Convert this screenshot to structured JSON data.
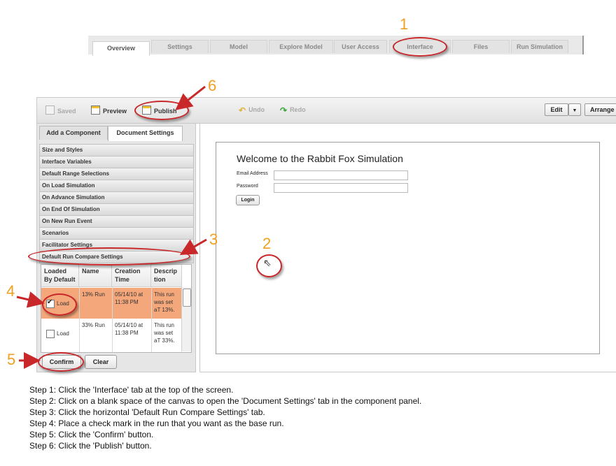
{
  "top_tabs": [
    "Overview",
    "Settings",
    "Model",
    "Explore Model",
    "User Access",
    "Interface",
    "Files",
    "Run Simulation"
  ],
  "step_numbers": [
    "1",
    "2",
    "3",
    "4",
    "5",
    "6"
  ],
  "toolbar": {
    "saved": "Saved",
    "preview": "Preview",
    "publish": "Publish",
    "undo": "Undo",
    "redo": "Redo",
    "edit": "Edit",
    "arrange": "Arrange"
  },
  "panel_tabs": [
    "Add a Component",
    "Document Settings"
  ],
  "sections": [
    "Size and Styles",
    "Interface Variables",
    "Default Range Selections",
    "On Load Simulation",
    "On Advance Simulation",
    "On End Of Simulation",
    "On New Run Event",
    "Scenarios",
    "Facilitator Settings",
    "Default Run Compare Settings"
  ],
  "run_table": {
    "headers": [
      "Loaded By Default",
      "Name",
      "Creation Time",
      "Descrip tion"
    ],
    "rows": [
      {
        "checked": true,
        "load": "Load",
        "name": "13% Run",
        "time": "05/14/10 at 11:38 PM",
        "desc": "This run was set aT 13%."
      },
      {
        "checked": false,
        "load": "Load",
        "name": "33% Run",
        "time": "05/14/10 at 11:38 PM",
        "desc": "This run was set aT 33%."
      }
    ]
  },
  "buttons": {
    "confirm": "Confirm",
    "clear": "Clear"
  },
  "canvas": {
    "title": "Welcome to the Rabbit Fox Simulation",
    "email_label": "Email Address",
    "password_label": "Password",
    "login": "Login"
  },
  "steps": [
    "Step 1: Click the 'Interface' tab at the top of the screen.",
    "Step 2: Click on a blank space of the canvas to open the 'Document Settings' tab in the component panel.",
    "Step 3: Click the horizontal 'Default Run Compare Settings' tab.",
    "Step 4: Place a check mark in the run that you want as the base run.",
    "Step 5: Click the 'Confirm' button.",
    "Step 6: Click the 'Publish' button."
  ],
  "colors": {
    "accent_number": "#f0a020",
    "annotation_red": "#c8282a",
    "selected_row": "#f4a77a"
  }
}
